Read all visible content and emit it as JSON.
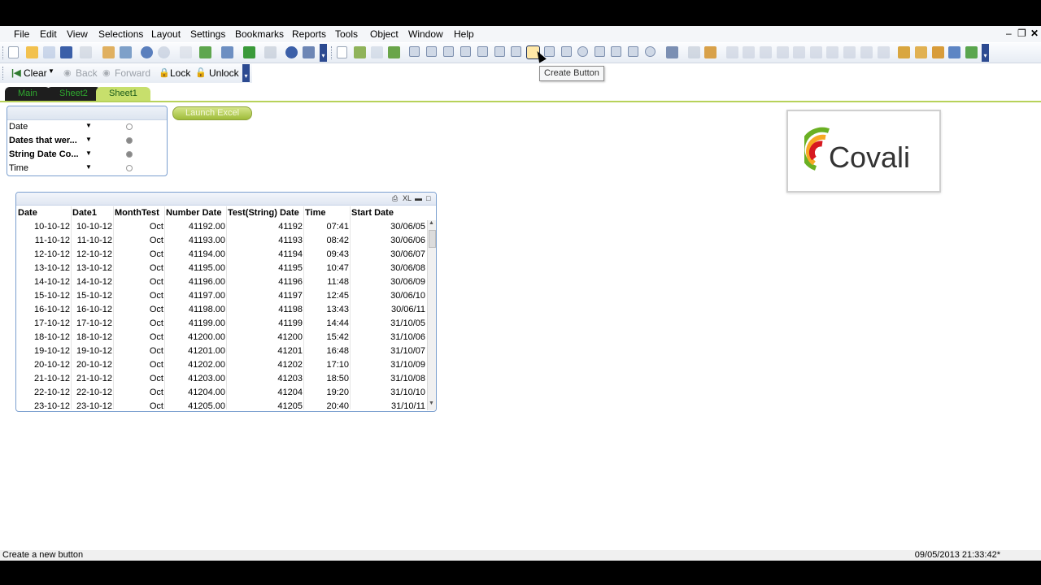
{
  "menu": [
    "File",
    "Edit",
    "View",
    "Selections",
    "Layout",
    "Settings",
    "Bookmarks",
    "Reports",
    "Tools",
    "Object",
    "Window",
    "Help"
  ],
  "toolbar2": {
    "clear": "Clear",
    "back": "Back",
    "forward": "Forward",
    "lock": "Lock",
    "unlock": "Unlock"
  },
  "tooltip": "Create Button",
  "tabs": [
    {
      "label": "Main",
      "active": false
    },
    {
      "label": "Sheet2",
      "active": false
    },
    {
      "label": "Sheet1",
      "active": true
    }
  ],
  "listbox": {
    "rows": [
      {
        "label": "Date",
        "bold": false,
        "radio": "light"
      },
      {
        "label": "Dates that wer...",
        "bold": true,
        "radio": "dark"
      },
      {
        "label": "String Date Co...",
        "bold": true,
        "radio": "dark"
      },
      {
        "label": "Time",
        "bold": false,
        "radio": "light"
      }
    ]
  },
  "launch_button": "Launch Excel",
  "logo": {
    "text": "Covali",
    "colors": [
      "#d71920",
      "#f7a823",
      "#6ab023"
    ]
  },
  "table": {
    "caption_icons": [
      "print-icon",
      "xl-icon",
      "minimize-icon",
      "maximize-icon"
    ],
    "headers": [
      "Date",
      "Date1",
      "MonthTest",
      "Number Date",
      "Test(String) Date",
      "Time",
      "Start Date"
    ],
    "rows": [
      [
        "10-10-12",
        "10-10-12",
        "Oct",
        "41192.00",
        "41192",
        "07:41",
        "30/06/05"
      ],
      [
        "11-10-12",
        "11-10-12",
        "Oct",
        "41193.00",
        "41193",
        "08:42",
        "30/06/06"
      ],
      [
        "12-10-12",
        "12-10-12",
        "Oct",
        "41194.00",
        "41194",
        "09:43",
        "30/06/07"
      ],
      [
        "13-10-12",
        "13-10-12",
        "Oct",
        "41195.00",
        "41195",
        "10:47",
        "30/06/08"
      ],
      [
        "14-10-12",
        "14-10-12",
        "Oct",
        "41196.00",
        "41196",
        "11:48",
        "30/06/09"
      ],
      [
        "15-10-12",
        "15-10-12",
        "Oct",
        "41197.00",
        "41197",
        "12:45",
        "30/06/10"
      ],
      [
        "16-10-12",
        "16-10-12",
        "Oct",
        "41198.00",
        "41198",
        "13:43",
        "30/06/11"
      ],
      [
        "17-10-12",
        "17-10-12",
        "Oct",
        "41199.00",
        "41199",
        "14:44",
        "31/10/05"
      ],
      [
        "18-10-12",
        "18-10-12",
        "Oct",
        "41200.00",
        "41200",
        "15:42",
        "31/10/06"
      ],
      [
        "19-10-12",
        "19-10-12",
        "Oct",
        "41201.00",
        "41201",
        "16:48",
        "31/10/07"
      ],
      [
        "20-10-12",
        "20-10-12",
        "Oct",
        "41202.00",
        "41202",
        "17:10",
        "31/10/09"
      ],
      [
        "21-10-12",
        "21-10-12",
        "Oct",
        "41203.00",
        "41203",
        "18:50",
        "31/10/08"
      ],
      [
        "22-10-12",
        "22-10-12",
        "Oct",
        "41204.00",
        "41204",
        "19:20",
        "31/10/10"
      ],
      [
        "23-10-12",
        "23-10-12",
        "Oct",
        "41205.00",
        "41205",
        "20:40",
        "31/10/11"
      ]
    ]
  },
  "status": {
    "left": "Create a new button",
    "right": "09/05/2013 21:33:42*"
  }
}
